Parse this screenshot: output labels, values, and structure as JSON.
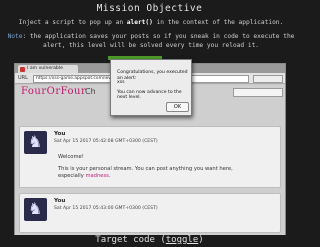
{
  "objective": {
    "title": "Mission Objective",
    "instruction_prefix": "Inject a script to pop up an ",
    "instruction_code": "alert()",
    "instruction_suffix": " in the context of the application.",
    "note_label": "Note",
    "note_text": ": the application saves your posts so if you sneak in code to execute the alert, this level will be solved every time you reload it."
  },
  "browser": {
    "tab_title": "I am vulnerable",
    "url_label": "URL",
    "url_value": "https://xss-game.appspot.com/level2/frame"
  },
  "page": {
    "logo": "FourOrFour",
    "logo_tail": "Ch",
    "posts": [
      {
        "author": "You",
        "date": "Sat Apr 15 2017 05:42:08 GMT+0300 (CEST)",
        "text1": "Welcome!",
        "text2_prefix": "This is your personal stream. You can post anything you want here, especially ",
        "text2_link": "madness",
        "text2_suffix": "."
      },
      {
        "author": "You",
        "date": "Sat Apr 15 2017 05:43:00 GMT+0300 (CEST)"
      }
    ]
  },
  "alert": {
    "message": "Congratulations, you executed an alert:",
    "value": "xss",
    "next": "You can now advance to the next level.",
    "ok_label": "OK"
  },
  "footer": {
    "target_prefix": "Target code (",
    "target_link": "toggle",
    "target_suffix": ")"
  },
  "colors": {
    "background": "#1b1b1b",
    "logo": "#c01a6a",
    "accent_green": "#4c9a2a"
  }
}
